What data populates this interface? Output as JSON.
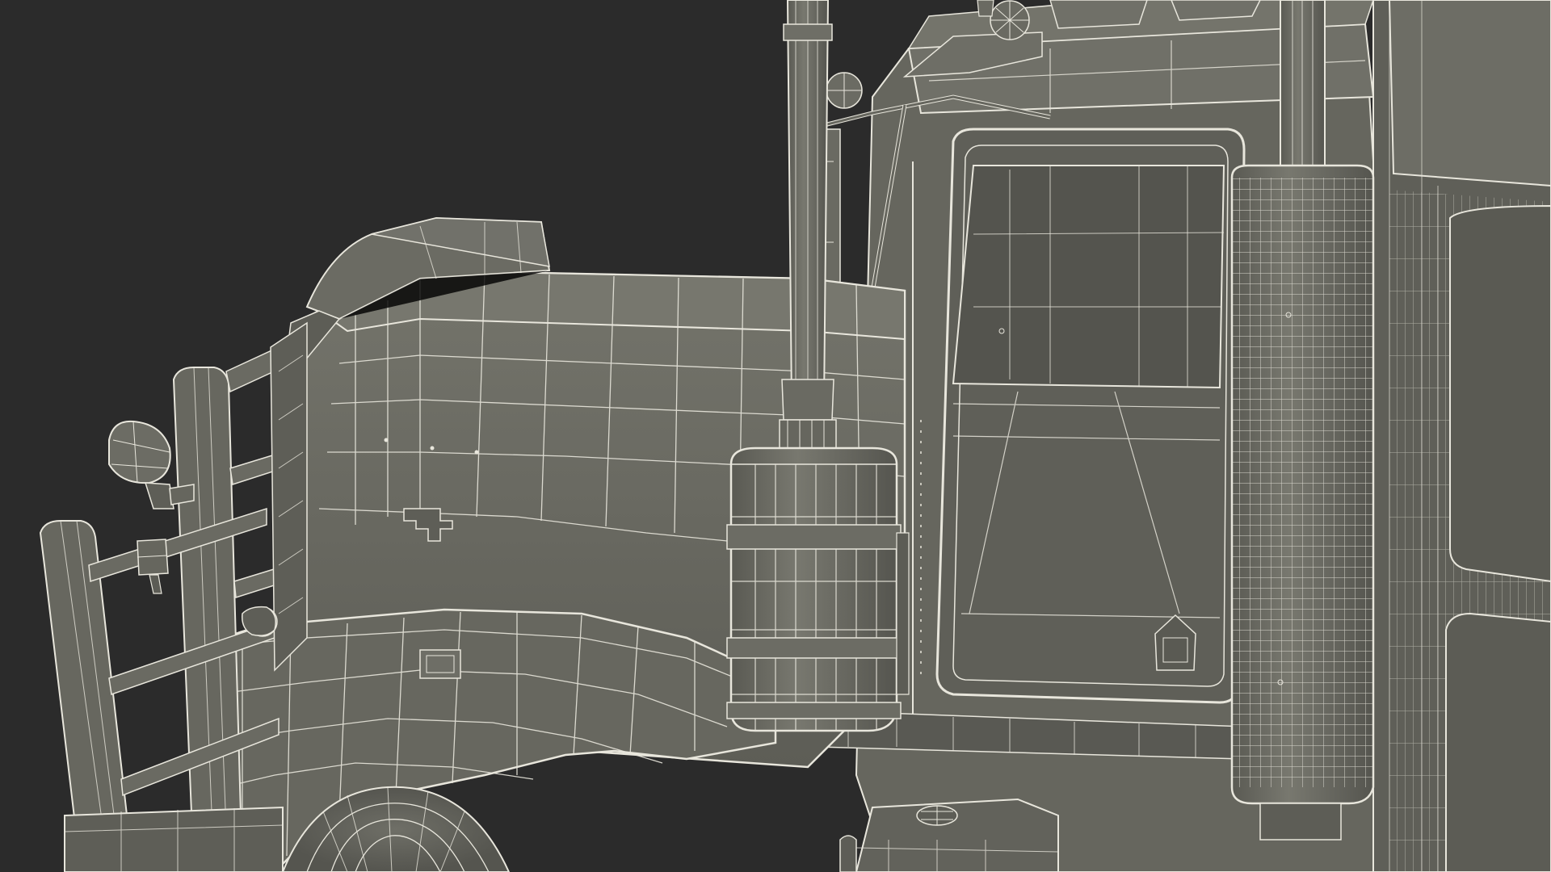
{
  "scene": {
    "subject": "semi-truck-wireframe-render",
    "colors": {
      "background": "#2b2b2b",
      "body_fill": "#6b6b63",
      "body_shade": "#5a5a53",
      "body_dark": "#4a4a44",
      "body_light": "#7c7c73",
      "wire": "#e8e6dc"
    }
  }
}
